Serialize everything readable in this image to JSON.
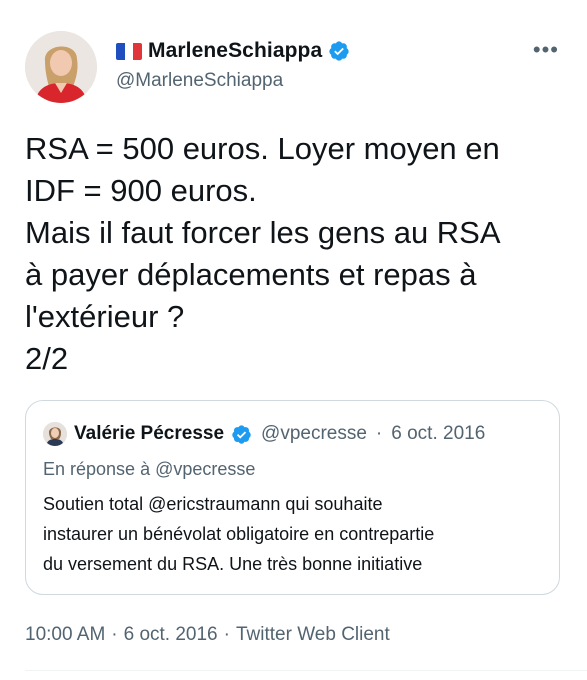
{
  "author": {
    "display_name": "MarleneSchiappa",
    "handle": "@MarleneSchiappa",
    "flag": "french-flag",
    "verified_badge": "verified-badge"
  },
  "tweet": {
    "text_lines": [
      "RSA = 500 euros. Loyer moyen en",
      "IDF = 900 euros.",
      "Mais il faut forcer les gens au RSA",
      "à payer déplacements et repas à",
      "l'extérieur ?",
      "2/2"
    ]
  },
  "quoted_tweet": {
    "display_name": "Valérie Pécresse",
    "handle": "@vpecresse",
    "separator": "·",
    "date": "6 oct. 2016",
    "reply_context": "En réponse à @vpecresse",
    "text_lines": [
      "Soutien total @ericstraumann qui souhaite",
      "instaurer un bénévolat obligatoire en contrepartie",
      "du versement du RSA. Une très bonne initiative"
    ]
  },
  "footer": {
    "time": "10:00 AM",
    "date": "6 oct. 2016",
    "source": "Twitter Web Client",
    "separator": "·"
  },
  "icons": {
    "more": "more-options-icon",
    "verified": "verified-badge-icon"
  },
  "colors": {
    "verified_blue": "#1d9bf0",
    "secondary_text": "#536471",
    "primary_text": "#0f1419",
    "border": "#cfd9de"
  }
}
